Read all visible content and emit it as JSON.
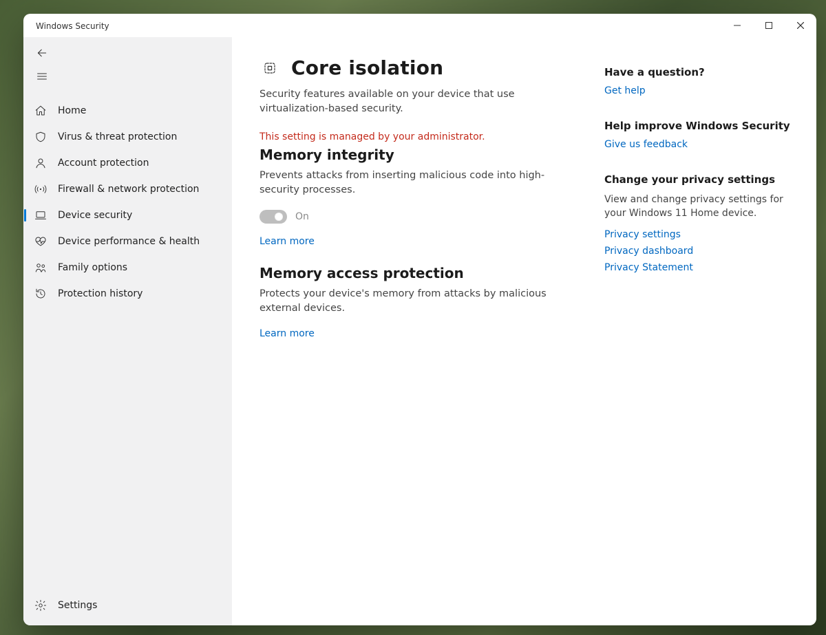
{
  "window": {
    "title": "Windows Security"
  },
  "sidebar": {
    "items": [
      {
        "label": "Home"
      },
      {
        "label": "Virus & threat protection"
      },
      {
        "label": "Account protection"
      },
      {
        "label": "Firewall & network protection"
      },
      {
        "label": "Device security"
      },
      {
        "label": "Device performance & health"
      },
      {
        "label": "Family options"
      },
      {
        "label": "Protection history"
      }
    ],
    "settings_label": "Settings"
  },
  "main": {
    "title": "Core isolation",
    "subtitle": "Security features available on your device that use virtualization-based security.",
    "admin_notice": "This setting is managed by your administrator.",
    "memory_integrity": {
      "heading": "Memory integrity",
      "desc": "Prevents attacks from inserting malicious code into high-security processes.",
      "toggle_state": "On",
      "learn_more": "Learn more"
    },
    "memory_access": {
      "heading": "Memory access protection",
      "desc": "Protects your device's memory from attacks by malicious external devices.",
      "learn_more": "Learn more"
    }
  },
  "aside": {
    "question": {
      "heading": "Have a question?",
      "link": "Get help"
    },
    "improve": {
      "heading": "Help improve Windows Security",
      "link": "Give us feedback"
    },
    "privacy": {
      "heading": "Change your privacy settings",
      "desc": "View and change privacy settings for your Windows 11 Home device.",
      "links": [
        "Privacy settings",
        "Privacy dashboard",
        "Privacy Statement"
      ]
    }
  }
}
